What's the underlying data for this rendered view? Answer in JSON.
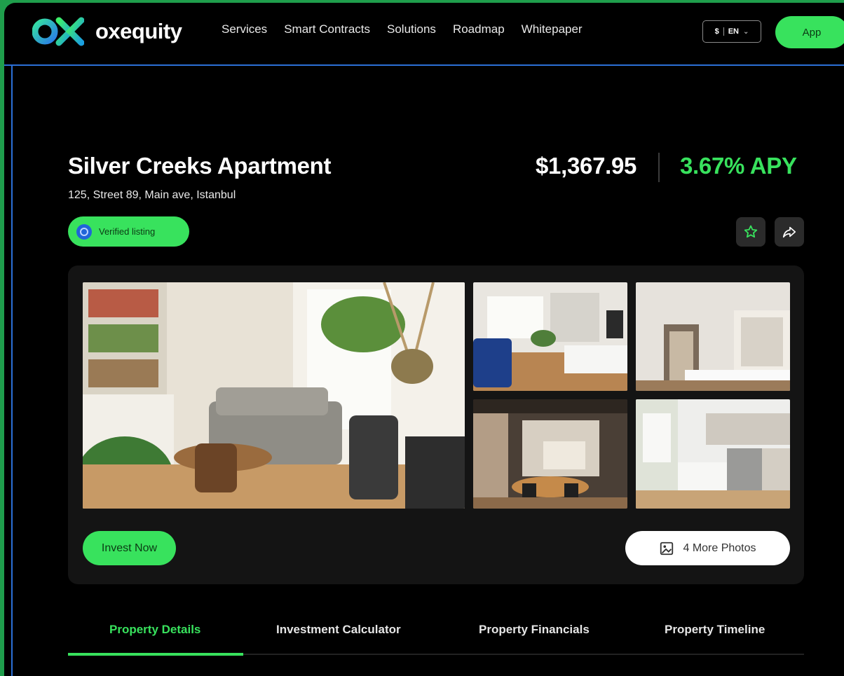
{
  "brand": {
    "name": "oxequity",
    "colors": {
      "accent": "#38e25d",
      "blue": "#2065d8",
      "background": "#000000"
    }
  },
  "nav": {
    "items": [
      "Services",
      "Smart Contracts",
      "Solutions",
      "Roadmap",
      "Whitepaper"
    ]
  },
  "header": {
    "currency": "$",
    "language": "EN",
    "app_label": "App"
  },
  "property": {
    "title": "Silver Creeks Apartment",
    "address": "125, Street 89, Main ave, Istanbul",
    "badge": "Verified listing",
    "price": "$1,367.95",
    "apy": "3.67% APY"
  },
  "actions": {
    "favorite_icon": "star-icon",
    "share_icon": "share-icon"
  },
  "gallery": {
    "photos": [
      "living-room",
      "living-room-blue-sofa",
      "bedroom",
      "dining-kitchen",
      "kitchen"
    ],
    "invest_label": "Invest Now",
    "more_photos_label": "4 More Photos"
  },
  "tabs": {
    "items": [
      "Property Details",
      "Investment Calculator",
      "Property Financials",
      "Property Timeline"
    ],
    "active": "Property Details"
  }
}
